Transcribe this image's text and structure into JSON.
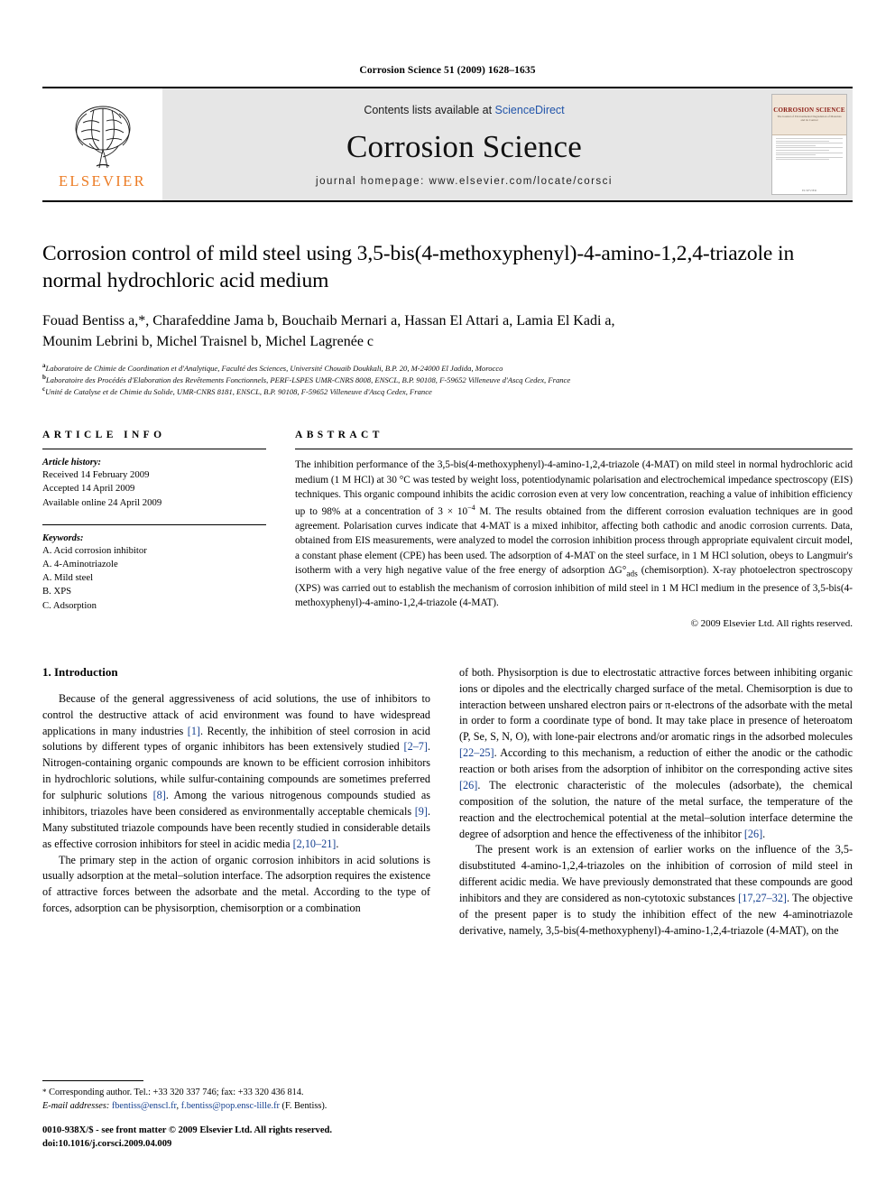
{
  "running_head": "Corrosion Science 51 (2009) 1628–1635",
  "masthead": {
    "publisher": "ELSEVIER",
    "contents_prefix": "Contents lists available at ",
    "contents_link": "ScienceDirect",
    "journal_name": "Corrosion Science",
    "homepage": "journal homepage: www.elsevier.com/locate/corsci",
    "cover": {
      "title": "CORROSION SCIENCE",
      "subtitle": "The Journal of Environmental Degradation of Materials and its Control",
      "footer": "ELSEVIER"
    },
    "link_color": "#2255aa",
    "brand_color": "#ec7b23",
    "band_color": "#e6e6e6"
  },
  "article": {
    "title": "Corrosion control of mild steel using 3,5-bis(4-methoxyphenyl)-4-amino-1,2,4-triazole in normal hydrochloric acid medium",
    "authors_line_1": "Fouad Bentiss a,*, Charafeddine Jama b, Bouchaib Mernari a, Hassan El Attari a, Lamia El Kadi a,",
    "authors_line_2": "Mounim Lebrini b, Michel Traisnel b, Michel Lagrenée c",
    "affiliations": [
      {
        "mark": "a",
        "text": "Laboratoire de Chimie de Coordination et d'Analytique, Faculté des Sciences, Université Chouaib Doukkali, B.P. 20, M-24000 El Jadida, Morocco"
      },
      {
        "mark": "b",
        "text": "Laboratoire des Procédés d'Elaboration des Revêtements Fonctionnels, PERF-LSPES UMR-CNRS 8008, ENSCL, B.P. 90108, F-59652 Villeneuve d'Ascq Cedex, France"
      },
      {
        "mark": "c",
        "text": "Unité de Catalyse et de Chimie du Solide, UMR-CNRS 8181, ENSCL, B.P. 90108, F-59652 Villeneuve d'Ascq Cedex, France"
      }
    ]
  },
  "article_info": {
    "heading": "ARTICLE INFO",
    "history_label": "Article history:",
    "history": [
      "Received 14 February 2009",
      "Accepted 14 April 2009",
      "Available online 24 April 2009"
    ],
    "keywords_label": "Keywords:",
    "keywords": [
      "A. Acid corrosion inhibitor",
      "A. 4-Aminotriazole",
      "A. Mild steel",
      "B. XPS",
      "C. Adsorption"
    ]
  },
  "abstract": {
    "heading": "ABSTRACT",
    "part_1": "The inhibition performance of the 3,5-bis(4-methoxyphenyl)-4-amino-1,2,4-triazole (4-MAT) on mild steel in normal hydrochloric acid medium (1 M HCl) at 30 °C was tested by weight loss, potentiodynamic polarisation and electrochemical impedance spectroscopy (EIS) techniques. This organic compound inhibits the acidic corrosion even at very low concentration, reaching a value of inhibition efficiency up to 98% at a concentration of 3 × 10",
    "exponent": "−4",
    "part_2": " M. The results obtained from the different corrosion evaluation techniques are in good agreement. Polarisation curves indicate that 4-MAT is a mixed inhibitor, affecting both cathodic and anodic corrosion currents. Data, obtained from EIS measurements, were analyzed to model the corrosion inhibition process through appropriate equivalent circuit model, a constant phase element (CPE) has been used. The adsorption of 4-MAT on the steel surface, in 1 M HCl solution, obeys to Langmuir's isotherm with a very high negative value of the free energy of adsorption ΔG°",
    "subscript": "ads",
    "part_3": " (chemisorption). X-ray photoelectron spectroscopy (XPS) was carried out to establish the mechanism of corrosion inhibition of mild steel in 1 M HCl medium in the presence of 3,5-bis(4-methoxyphenyl)-4-amino-1,2,4-triazole (4-MAT).",
    "copyright": "© 2009 Elsevier Ltd. All rights reserved."
  },
  "introduction": {
    "section_title": "1. Introduction",
    "left": {
      "p1_a": "Because of the general aggressiveness of acid solutions, the use of inhibitors to control the destructive attack of acid environment was found to have widespread applications in many industries ",
      "p1_c1": "[1]",
      "p1_b": ". Recently, the inhibition of steel corrosion in acid solutions by different types of organic inhibitors has been extensively studied ",
      "p1_c2": "[2–7]",
      "p1_d": ". Nitrogen-containing organic compounds are known to be efficient corrosion inhibitors in hydrochloric solutions, while sulfur-containing compounds are sometimes preferred for sulphuric solutions ",
      "p1_c3": "[8]",
      "p1_e": ". Among the various nitrogenous compounds studied as inhibitors, triazoles have been considered as environmentally acceptable chemicals ",
      "p1_c4": "[9]",
      "p1_f": ". Many substituted triazole compounds have been recently studied in considerable details as effective corrosion inhibitors for steel in acidic media ",
      "p1_c5": "[2,10–21]",
      "p1_g": ".",
      "p2": "The primary step in the action of organic corrosion inhibitors in acid solutions is usually adsorption at the metal–solution interface. The adsorption requires the existence of attractive forces between the adsorbate and the metal. According to the type of forces, adsorption can be physisorption, chemisorption or a combination"
    },
    "right": {
      "p1_a": "of both. Physisorption is due to electrostatic attractive forces between inhibiting organic ions or dipoles and the electrically charged surface of the metal. Chemisorption is due to interaction between unshared electron pairs or π-electrons of the adsorbate with the metal in order to form a coordinate type of bond. It may take place in presence of heteroatom (P, Se, S, N, O), with lone-pair electrons and/or aromatic rings in the adsorbed molecules ",
      "p1_c1": "[22–25]",
      "p1_b": ". According to this mechanism, a reduction of either the anodic or the cathodic reaction or both arises from the adsorption of inhibitor on the corresponding active sites ",
      "p1_c2": "[26]",
      "p1_c": ". The electronic characteristic of the molecules (adsorbate), the chemical composition of the solution, the nature of the metal surface, the temperature of the reaction and the electrochemical potential at the metal–solution interface determine the degree of adsorption and hence the effectiveness of the inhibitor ",
      "p1_c3": "[26]",
      "p1_d": ".",
      "p2_a": "The present work is an extension of earlier works on the influence of the 3,5-disubstituted 4-amino-1,2,4-triazoles on the inhibition of corrosion of mild steel in different acidic media. We have previously demonstrated that these compounds are good inhibitors and they are considered as non-cytotoxic substances ",
      "p2_c1": "[17,27–32]",
      "p2_b": ". The objective of the present paper is to study the inhibition effect of the new 4-aminotriazole derivative, namely, 3,5-bis(4-methoxyphenyl)-4-amino-1,2,4-triazole (4-MAT), on the"
    }
  },
  "footnotes": {
    "corresponding_bullet": "*",
    "corresponding": " Corresponding author. Tel.: +33 320 337 746; fax: +33 320 436 814.",
    "email_label": "E-mail addresses:",
    "email_1": "fbentiss@enscl.fr",
    "email_sep": ", ",
    "email_2": "f.bentiss@pop.ensc-lille.fr",
    "email_suffix": " (F. Bentiss).",
    "issn_line": "0010-938X/$ - see front matter © 2009 Elsevier Ltd. All rights reserved.",
    "doi_line": "doi:10.1016/j.corsci.2009.04.009"
  }
}
